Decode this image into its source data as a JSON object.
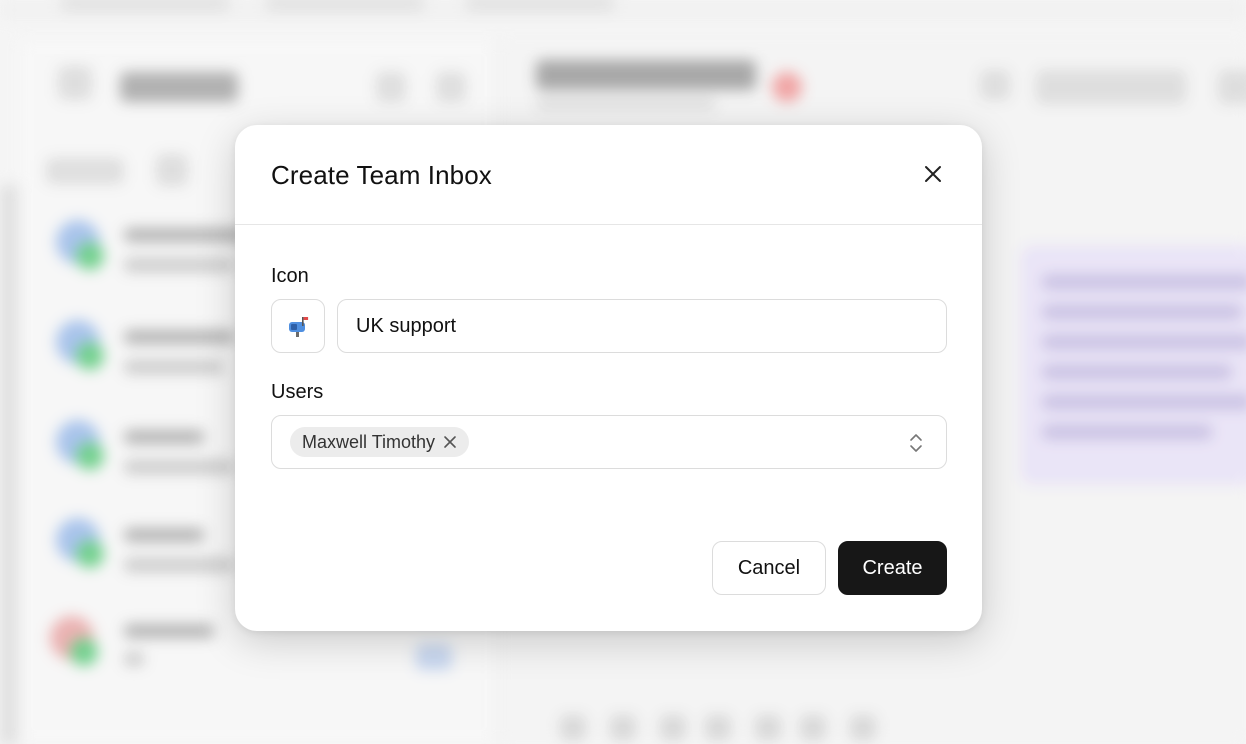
{
  "dialog": {
    "title": "Create Team Inbox",
    "icon_label": "Icon",
    "selected_icon": "📬",
    "name_value": "UK support",
    "users_label": "Users",
    "selected_users": [
      {
        "name": "Maxwell Timothy"
      }
    ],
    "cancel_label": "Cancel",
    "create_label": "Create"
  },
  "colors": {
    "primary_button_bg": "#171717",
    "primary_button_text": "#ffffff",
    "border": "#dcdcdc",
    "chip_bg": "#ececec"
  },
  "icons": {
    "close": "close-icon",
    "chip_remove": "close-icon",
    "select_toggle": "chevron-up-down-icon",
    "inbox_emoji": "mailbox-icon"
  }
}
